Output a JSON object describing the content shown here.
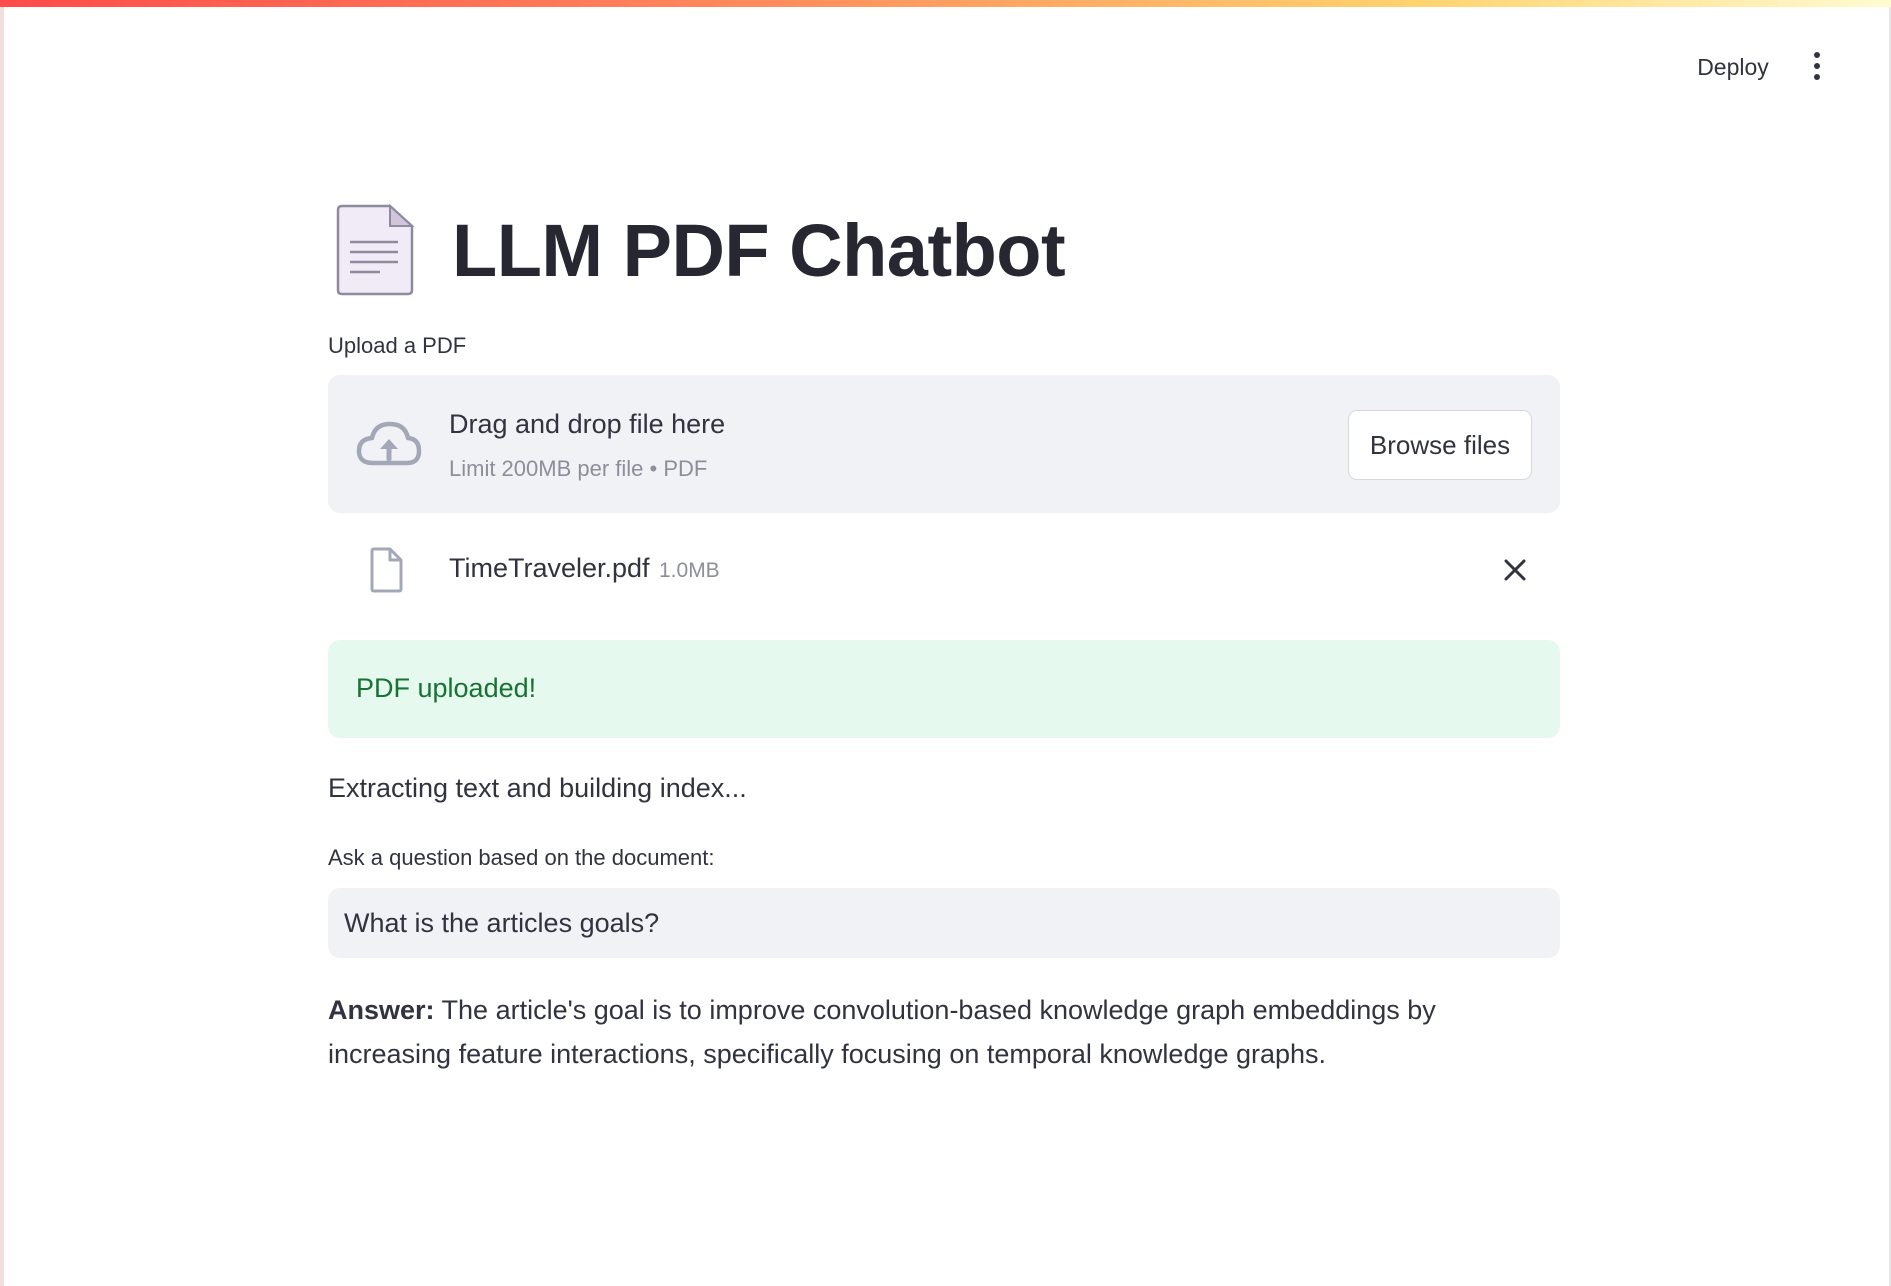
{
  "header": {
    "deploy_label": "Deploy",
    "menu_icon": "more-vertical-icon"
  },
  "page": {
    "title_icon": "document-icon",
    "title": "LLM PDF Chatbot"
  },
  "uploader": {
    "label": "Upload a PDF",
    "drop_icon": "cloud-upload-icon",
    "drop_title": "Drag and drop file here",
    "drop_limit": "Limit 200MB per file • PDF",
    "browse_label": "Browse files"
  },
  "uploaded_file": {
    "icon": "file-icon",
    "name": "TimeTraveler.pdf",
    "size": "1.0MB",
    "remove_icon": "close-icon"
  },
  "success": {
    "message": "PDF uploaded!",
    "color": "#177233",
    "background": "#e6f9ee"
  },
  "status": {
    "text": "Extracting text and building index..."
  },
  "question": {
    "label": "Ask a question based on the document:",
    "value": "What is the articles goals?"
  },
  "answer": {
    "label": "Answer:",
    "text": "The article's goal is to improve convolution-based knowledge graph embeddings by increasing feature interactions, specifically focusing on temporal knowledge graphs."
  },
  "colors": {
    "accent_gradient_start": "#ff4b4b",
    "accent_gradient_end": "#fffbd1",
    "panel_background": "#f0f2f6",
    "text": "#31333f"
  }
}
